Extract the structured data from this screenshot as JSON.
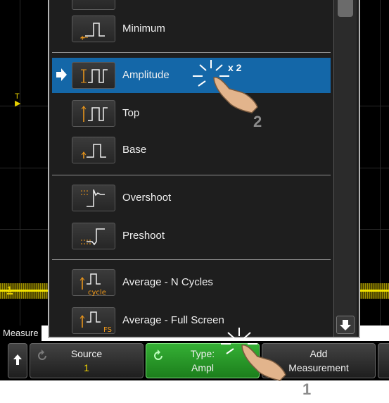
{
  "scope": {
    "trigger_marker": "T",
    "channel_marker": "1"
  },
  "menu": {
    "items": [
      {
        "label": "Minimum",
        "icon": "minimum-icon"
      },
      {
        "label": "Amplitude",
        "icon": "amplitude-icon",
        "selected": true
      },
      {
        "label": "Top",
        "icon": "top-icon"
      },
      {
        "label": "Base",
        "icon": "base-icon"
      },
      {
        "label": "Overshoot",
        "icon": "overshoot-icon"
      },
      {
        "label": "Preshoot",
        "icon": "preshoot-icon"
      },
      {
        "label": "Average - N Cycles",
        "icon": "average-n-cycles-icon",
        "icon_text": "cycle"
      },
      {
        "label": "Average - Full Screen",
        "icon": "average-full-screen-icon",
        "icon_text": "FS"
      }
    ]
  },
  "softkeys": {
    "menu_title": "Measure",
    "source": {
      "label": "Source",
      "value": "1"
    },
    "type": {
      "label": "Type:",
      "value": "Ampl"
    },
    "add": {
      "line1": "Add",
      "line2": "Measurement"
    }
  },
  "annotations": {
    "tap_count": "x 2",
    "step1": "1",
    "step2": "2"
  },
  "colors": {
    "selected": "#1467a8",
    "trace": "#f2e200",
    "active_softkey": "#2a9a2a",
    "source_value": "#f2d400"
  }
}
